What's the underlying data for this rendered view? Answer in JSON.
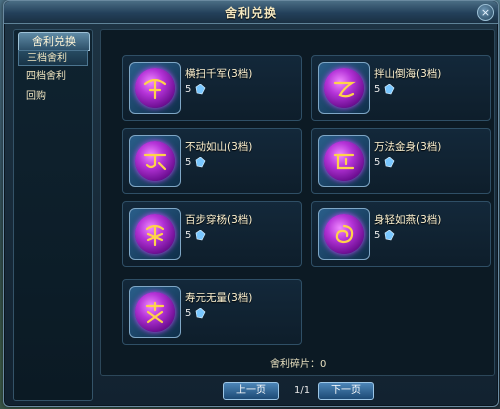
{
  "window": {
    "title": "舍利兑换"
  },
  "sidebar": {
    "tab_label": "舍利兑换",
    "items": [
      {
        "label": "三档舍利",
        "active": true
      },
      {
        "label": "四档舍利",
        "active": false
      },
      {
        "label": "回购",
        "active": false
      }
    ]
  },
  "relics": [
    {
      "name": "横扫千军(3档)",
      "cost": "5",
      "glyph": "glyph-umbrella-icon"
    },
    {
      "name": "拌山倒海(3档)",
      "cost": "5",
      "glyph": "glyph-curl-icon"
    },
    {
      "name": "不动如山(3档)",
      "cost": "5",
      "glyph": "glyph-hook-icon"
    },
    {
      "name": "万法金身(3档)",
      "cost": "5",
      "glyph": "glyph-bracket-icon"
    },
    {
      "name": "百步穿杨(3档)",
      "cost": "5",
      "glyph": "glyph-star-icon"
    },
    {
      "name": "身轻如燕(3档)",
      "cost": "5",
      "glyph": "glyph-spiral-icon"
    },
    {
      "name": "寿元无量(3档)",
      "cost": "5",
      "glyph": "glyph-cross-icon"
    }
  ],
  "footer": {
    "shards_text": "舍利碎片：0"
  },
  "pagination": {
    "prev_label": "上一页",
    "next_label": "下一页",
    "page_text": "1/1"
  },
  "colors": {
    "orb": "#b533d8",
    "glyph": "#ffd34a",
    "text": "#fff3d0"
  }
}
